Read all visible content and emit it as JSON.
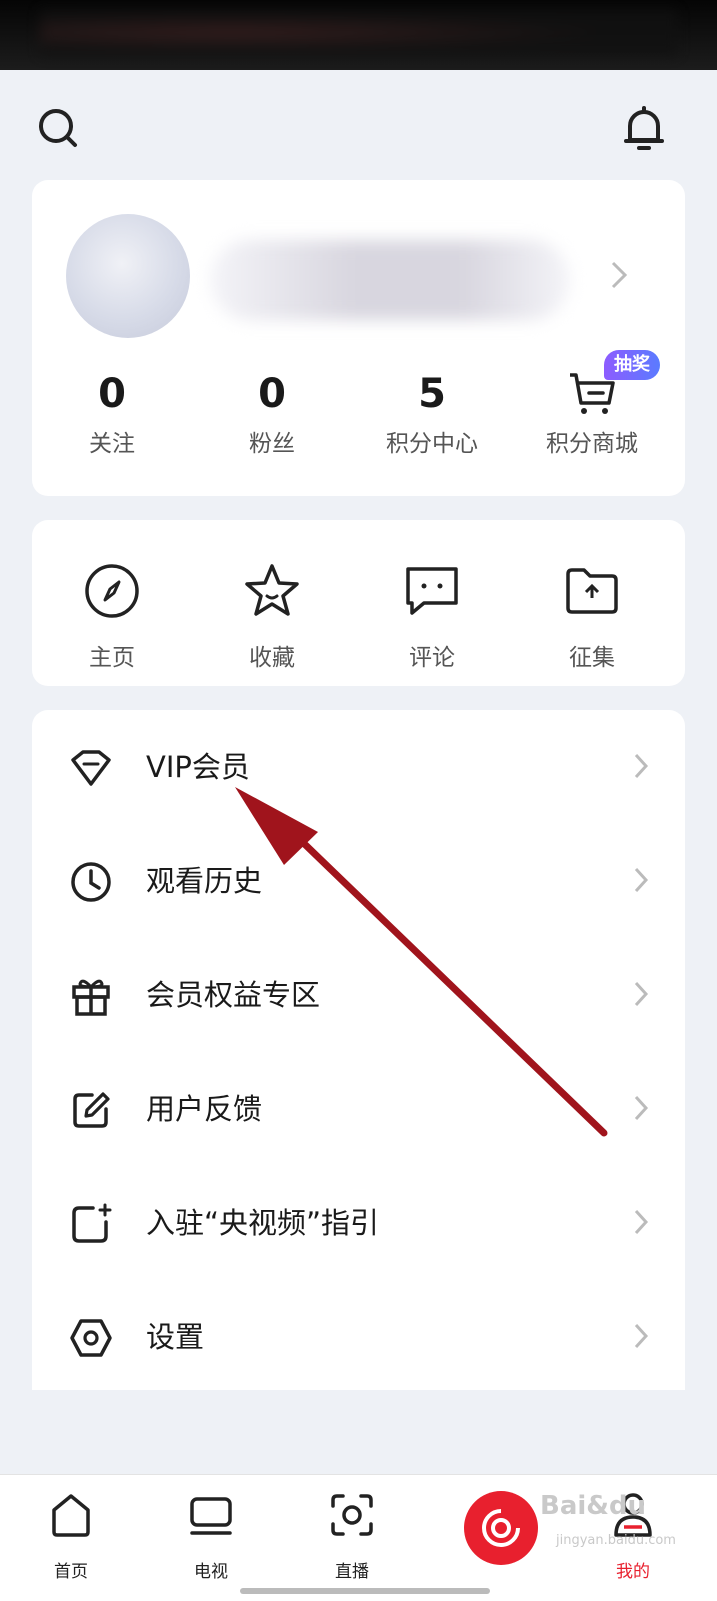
{
  "profile": {
    "stats": [
      {
        "num": "0",
        "label": "关注"
      },
      {
        "num": "0",
        "label": "粉丝"
      },
      {
        "num": "5",
        "label": "积分中心"
      }
    ],
    "shop_label": "积分商城",
    "shop_badge": "抽奖"
  },
  "quick_actions": [
    {
      "label": "主页",
      "icon": "compass-icon"
    },
    {
      "label": "收藏",
      "icon": "star-icon"
    },
    {
      "label": "评论",
      "icon": "comment-icon"
    },
    {
      "label": "征集",
      "icon": "folder-upload-icon"
    }
  ],
  "menu": [
    {
      "label": "VIP会员",
      "icon": "diamond-icon"
    },
    {
      "label": "观看历史",
      "icon": "clock-icon"
    },
    {
      "label": "会员权益专区",
      "icon": "gift-icon"
    },
    {
      "label": "用户反馈",
      "icon": "edit-icon"
    },
    {
      "label": "入驻“央视频”指引",
      "icon": "add-square-icon"
    },
    {
      "label": "设置",
      "icon": "hexagon-settings-icon"
    }
  ],
  "tabbar": [
    {
      "label": "首页",
      "icon": "home-icon"
    },
    {
      "label": "电视",
      "icon": "tv-icon"
    },
    {
      "label": "直播",
      "icon": "live-icon"
    },
    {
      "label": "我的",
      "icon": "user-icon"
    }
  ],
  "watermark": {
    "text": "Bai&du",
    "sub": "jingyan.baidu.com"
  },
  "colors": {
    "accent": "#e8202e",
    "annotation_arrow": "#a0141c",
    "badge": "#7a63ff"
  }
}
